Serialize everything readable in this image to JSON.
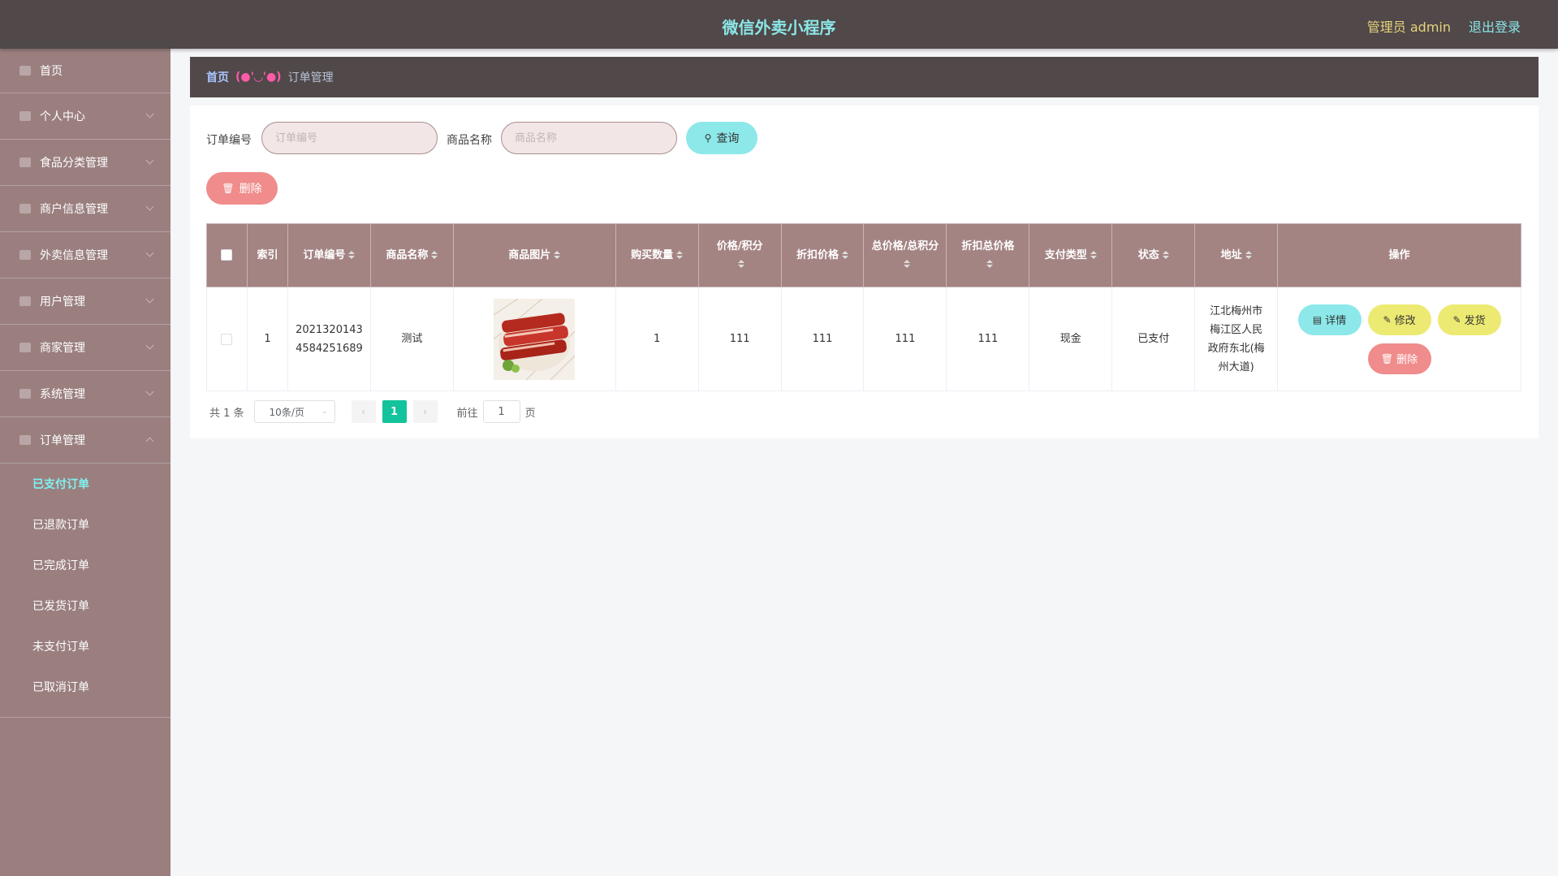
{
  "header": {
    "title": "微信外卖小程序",
    "admin": "管理员 admin",
    "logout": "退出登录"
  },
  "sidebar": {
    "items": [
      {
        "label": "首页",
        "icon": "home-icon"
      },
      {
        "label": "个人中心",
        "icon": "user-icon"
      },
      {
        "label": "食品分类管理",
        "icon": "list-icon"
      },
      {
        "label": "商户信息管理",
        "icon": "document-icon"
      },
      {
        "label": "外卖信息管理",
        "icon": "delivery-icon"
      },
      {
        "label": "用户管理",
        "icon": "users-icon"
      },
      {
        "label": "商家管理",
        "icon": "shop-icon"
      },
      {
        "label": "系统管理",
        "icon": "settings-icon"
      },
      {
        "label": "订单管理",
        "icon": "flag-icon"
      }
    ],
    "submenu": [
      {
        "label": "已支付订单",
        "active": true
      },
      {
        "label": "已退款订单"
      },
      {
        "label": "已完成订单"
      },
      {
        "label": "已发货订单"
      },
      {
        "label": "未支付订单"
      },
      {
        "label": "已取消订单"
      }
    ]
  },
  "breadcrumb": {
    "home": "首页",
    "separator": "(●'◡'●)",
    "current": "订单管理"
  },
  "search": {
    "order_no_label": "订单编号",
    "order_no_placeholder": "订单编号",
    "order_no_value": "",
    "product_label": "商品名称",
    "product_placeholder": "商品名称",
    "product_value": "",
    "query_button": "查询",
    "delete_button": "删除"
  },
  "table": {
    "headers": [
      "索引",
      "订单编号",
      "商品名称",
      "商品图片",
      "购买数量",
      "价格/积分",
      "折扣价格",
      "总价格/总积分",
      "折扣总价格",
      "支付类型",
      "状态",
      "地址",
      "操作"
    ],
    "rows": [
      {
        "index": "1",
        "order_no_line1": "2021320143",
        "order_no_line2": "4584251689",
        "product": "测试",
        "image": "food-photo",
        "quantity": "1",
        "price": "111",
        "discount_price": "111",
        "total_price": "111",
        "discount_total": "111",
        "pay_type": "现金",
        "status": "已支付",
        "address_line1": "江北梅州市",
        "address_line2": "梅江区人民",
        "address_line3": "政府东北(梅",
        "address_line4": "州大道)",
        "actions": {
          "detail": "详情",
          "edit": "修改",
          "ship": "发货",
          "delete": "删除"
        }
      }
    ]
  },
  "pagination": {
    "total": "共 1 条",
    "page_size": "10条/页",
    "current_page": "1",
    "goto_label": "前往",
    "goto_value": "1",
    "page_suffix": "页"
  },
  "colors": {
    "header_bg": "#504849",
    "sidebar_bg": "#9b7f7f",
    "table_header_bg": "#a48383",
    "accent_cyan": "#8de8e9",
    "accent_yellow": "#ecea72",
    "accent_red": "#f08c8c",
    "pager_active": "#13c39b"
  }
}
